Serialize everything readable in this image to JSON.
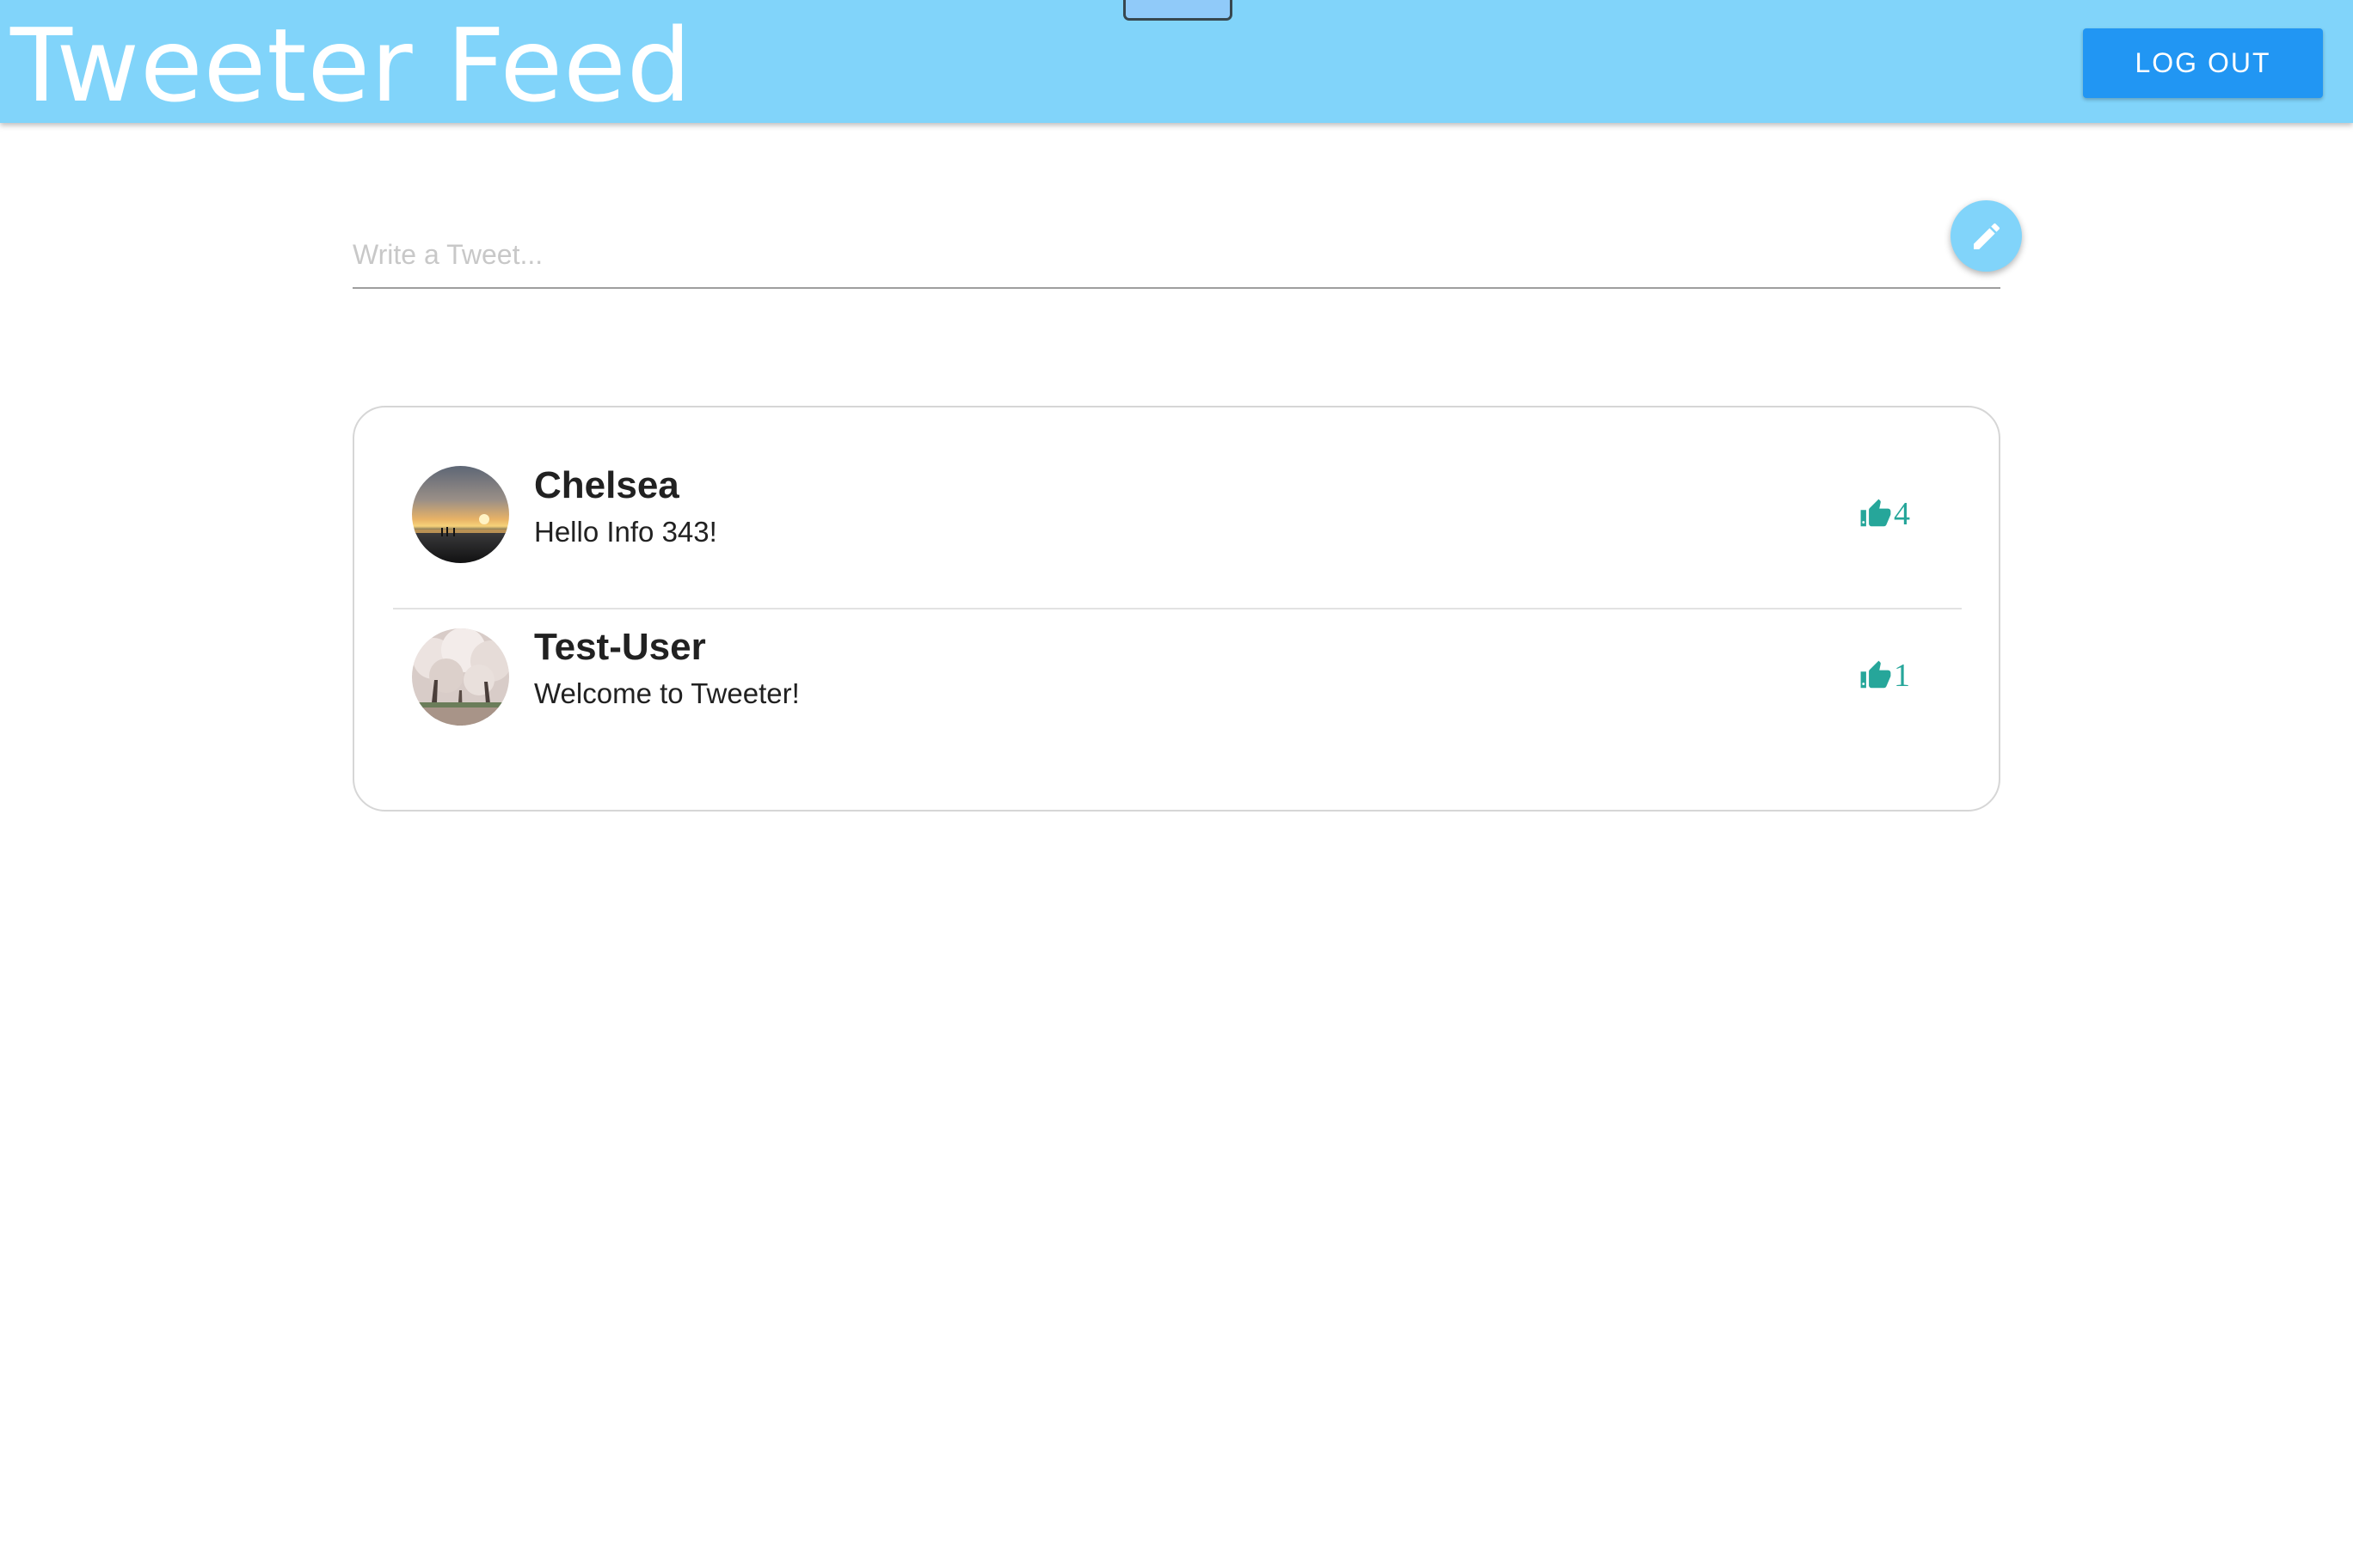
{
  "header": {
    "title": "Tweeter Feed",
    "logout_label": "LOG OUT",
    "background_color": "#81d4fa"
  },
  "compose": {
    "placeholder": "Write a Tweet...",
    "submit_icon": "pencil-icon"
  },
  "feed": {
    "items": [
      {
        "author": "Chelsea",
        "message": "Hello Info 343!",
        "likes": "4",
        "avatar": "sunset-photo"
      },
      {
        "author": "Test-User",
        "message": "Welcome to Tweeter!",
        "likes": "1",
        "avatar": "cherry-blossom-photo"
      }
    ],
    "like_icon": "thumbs-up-icon",
    "like_color": "#26a69a"
  }
}
